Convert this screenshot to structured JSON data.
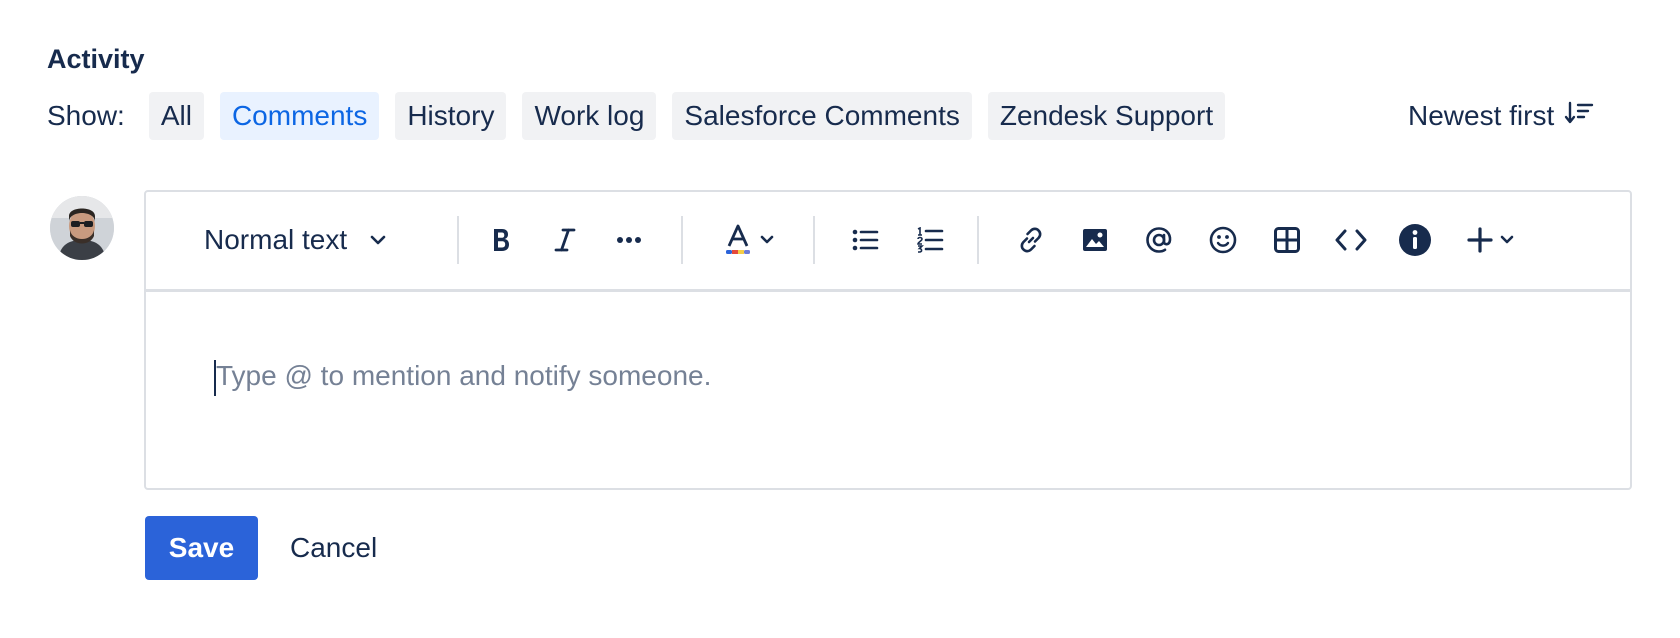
{
  "activity": {
    "title": "Activity"
  },
  "filters": {
    "show_label": "Show:",
    "options": [
      {
        "label": "All",
        "active": false
      },
      {
        "label": "Comments",
        "active": true
      },
      {
        "label": "History",
        "active": false
      },
      {
        "label": "Work log",
        "active": false
      },
      {
        "label": "Salesforce Comments",
        "active": false
      },
      {
        "label": "Zendesk Support",
        "active": false
      }
    ],
    "sort_label": "Newest first"
  },
  "editor": {
    "text_style": "Normal text",
    "placeholder": "Type @ to mention and notify someone.",
    "toolbar_icons": [
      "bold-icon",
      "italic-icon",
      "more-formatting-icon",
      "text-color-icon",
      "bullet-list-icon",
      "numbered-list-icon",
      "link-icon",
      "image-icon",
      "mention-icon",
      "emoji-icon",
      "table-icon",
      "code-icon",
      "info-panel-icon",
      "insert-plus-icon"
    ]
  },
  "actions": {
    "save_label": "Save",
    "cancel_label": "Cancel"
  },
  "colors": {
    "accent": "#2b63d9",
    "active_chip_bg": "#e9f2ff",
    "active_chip_text": "#0c66e4",
    "chip_bg": "#f1f2f4",
    "text": "#172b4d",
    "placeholder": "#758195"
  }
}
